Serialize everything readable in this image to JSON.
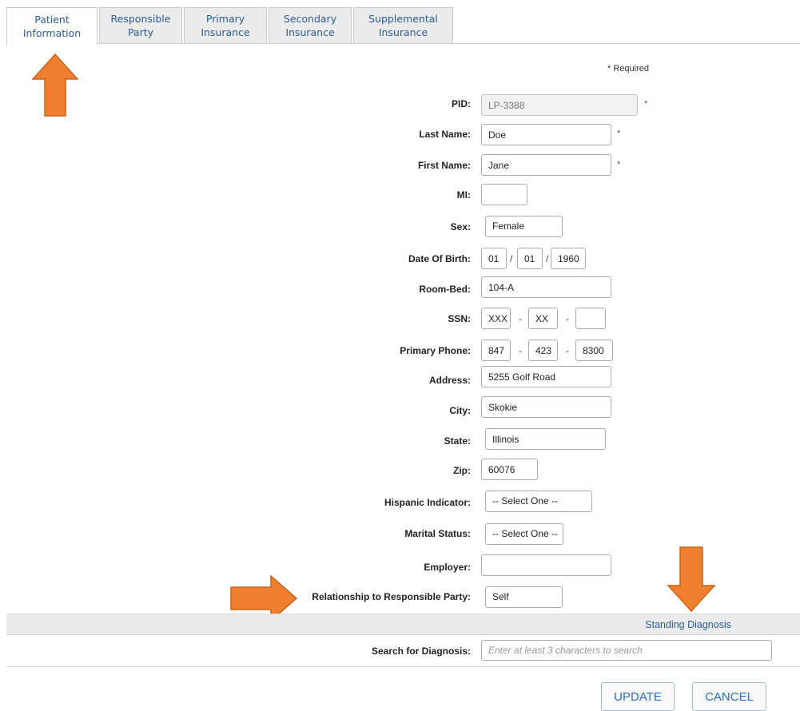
{
  "tabs": [
    {
      "line1": "Patient",
      "line2": "Information",
      "active": true
    },
    {
      "line1": "Responsible",
      "line2": "Party",
      "active": false
    },
    {
      "line1": "Primary",
      "line2": "Insurance",
      "active": false
    },
    {
      "line1": "Secondary",
      "line2": "Insurance",
      "active": false
    },
    {
      "line1": "Supplemental",
      "line2": "Insurance",
      "active": false
    }
  ],
  "required_note": "* Required",
  "required_marker": "*",
  "form": {
    "pid": {
      "label": "PID:",
      "value": "LP-3388"
    },
    "last_name": {
      "label": "Last Name:",
      "value": "Doe"
    },
    "first_name": {
      "label": "First Name:",
      "value": "Jane"
    },
    "mi": {
      "label": "MI:",
      "value": ""
    },
    "sex": {
      "label": "Sex:",
      "value": "Female"
    },
    "dob": {
      "label": "Date Of Birth:",
      "month": "01",
      "day": "01",
      "year": "1960",
      "sep": "/"
    },
    "room_bed": {
      "label": "Room-Bed:",
      "value": "104-A"
    },
    "ssn": {
      "label": "SSN:",
      "part1": "XXX",
      "part2": "XX",
      "part3": "",
      "sep": "-"
    },
    "primary_phone": {
      "label": "Primary Phone:",
      "area": "847",
      "prefix": "423",
      "line": "8300",
      "sep": "-"
    },
    "address": {
      "label": "Address:",
      "value": "5255 Golf Road"
    },
    "city": {
      "label": "City:",
      "value": "Skokie"
    },
    "state": {
      "label": "State:",
      "value": "Illinois"
    },
    "zip": {
      "label": "Zip:",
      "value": "60076"
    },
    "hispanic_indicator": {
      "label": "Hispanic Indicator:",
      "value": "-- Select One --"
    },
    "marital_status": {
      "label": "Marital Status:",
      "value": "-- Select One --"
    },
    "employer": {
      "label": "Employer:",
      "value": ""
    },
    "relationship": {
      "label": "Relationship to Responsible Party:",
      "value": "Self"
    }
  },
  "standing_diagnosis": {
    "title": "Standing Diagnosis",
    "search_label": "Search for Diagnosis:",
    "search_placeholder": "Enter at least 3 characters to search"
  },
  "buttons": {
    "update": "UPDATE",
    "cancel": "CANCEL"
  },
  "colors": {
    "tab_text": "#2a5c8f",
    "button_text": "#2d6db3",
    "arrow": "#f08030"
  },
  "icons": [
    "arrow-up-icon",
    "arrow-right-icon",
    "arrow-down-icon"
  ]
}
